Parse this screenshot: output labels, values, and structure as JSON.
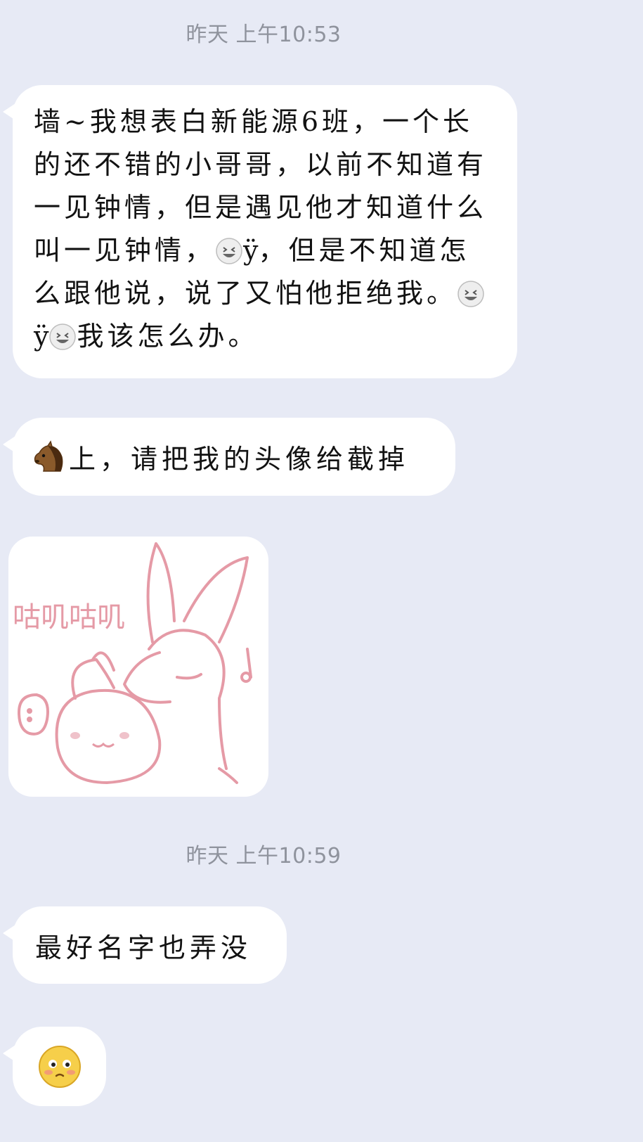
{
  "chat": {
    "timestamp_1": "昨天 上午10:53",
    "msg1": {
      "part1": "墙~我想表白新能源6班，一个长的还不错的小哥哥，以前不知道有一见钟情，但是遇见他才知道什么叫一见钟情，",
      "glyph1": "ÿ",
      "part2": "，但是不知道怎么跟他说，说了又怕他拒绝我。",
      "glyph2": "ÿ",
      "part3": "我该怎么办。",
      "emoji_icon": "grin-emoji-icon"
    },
    "msg2": {
      "text": "上，请把我的头像给截掉",
      "emoji_icon": "horse-emoji-icon"
    },
    "sticker": {
      "text": "咕叽咕叽",
      "icon": "bunny-sticker",
      "color": "#e59aa6"
    },
    "timestamp_2": "昨天 上午10:59",
    "msg3": {
      "text": "最好名字也弄没"
    },
    "msg4": {
      "emoji_icon": "flushed-emoji-icon"
    }
  },
  "colors": {
    "background": "#e7eaf5",
    "bubble": "#ffffff",
    "timestamp": "#8f939d"
  }
}
